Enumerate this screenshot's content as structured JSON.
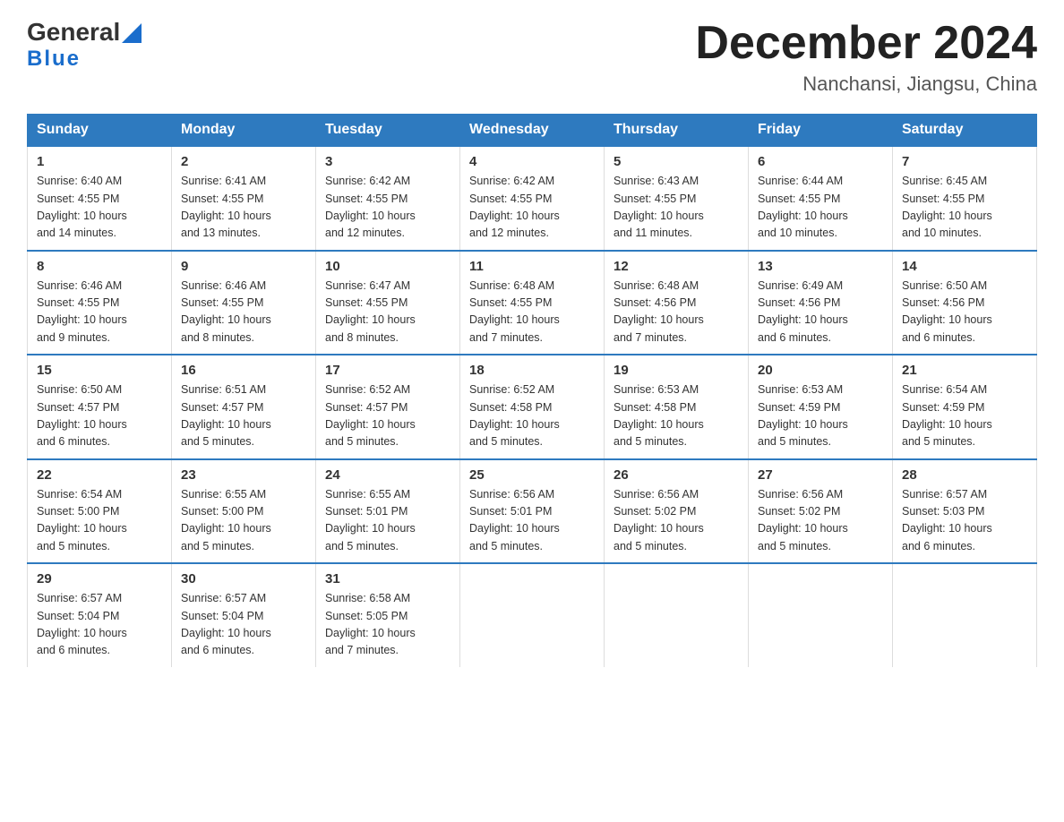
{
  "logo": {
    "text_general": "General",
    "text_blue": "Blue",
    "arrow_color": "#1a6dcc"
  },
  "title": "December 2024",
  "subtitle": "Nanchansi, Jiangsu, China",
  "days_of_week": [
    "Sunday",
    "Monday",
    "Tuesday",
    "Wednesday",
    "Thursday",
    "Friday",
    "Saturday"
  ],
  "weeks": [
    [
      {
        "day": "1",
        "sunrise": "6:40 AM",
        "sunset": "4:55 PM",
        "daylight": "10 hours and 14 minutes."
      },
      {
        "day": "2",
        "sunrise": "6:41 AM",
        "sunset": "4:55 PM",
        "daylight": "10 hours and 13 minutes."
      },
      {
        "day": "3",
        "sunrise": "6:42 AM",
        "sunset": "4:55 PM",
        "daylight": "10 hours and 12 minutes."
      },
      {
        "day": "4",
        "sunrise": "6:42 AM",
        "sunset": "4:55 PM",
        "daylight": "10 hours and 12 minutes."
      },
      {
        "day": "5",
        "sunrise": "6:43 AM",
        "sunset": "4:55 PM",
        "daylight": "10 hours and 11 minutes."
      },
      {
        "day": "6",
        "sunrise": "6:44 AM",
        "sunset": "4:55 PM",
        "daylight": "10 hours and 10 minutes."
      },
      {
        "day": "7",
        "sunrise": "6:45 AM",
        "sunset": "4:55 PM",
        "daylight": "10 hours and 10 minutes."
      }
    ],
    [
      {
        "day": "8",
        "sunrise": "6:46 AM",
        "sunset": "4:55 PM",
        "daylight": "10 hours and 9 minutes."
      },
      {
        "day": "9",
        "sunrise": "6:46 AM",
        "sunset": "4:55 PM",
        "daylight": "10 hours and 8 minutes."
      },
      {
        "day": "10",
        "sunrise": "6:47 AM",
        "sunset": "4:55 PM",
        "daylight": "10 hours and 8 minutes."
      },
      {
        "day": "11",
        "sunrise": "6:48 AM",
        "sunset": "4:55 PM",
        "daylight": "10 hours and 7 minutes."
      },
      {
        "day": "12",
        "sunrise": "6:48 AM",
        "sunset": "4:56 PM",
        "daylight": "10 hours and 7 minutes."
      },
      {
        "day": "13",
        "sunrise": "6:49 AM",
        "sunset": "4:56 PM",
        "daylight": "10 hours and 6 minutes."
      },
      {
        "day": "14",
        "sunrise": "6:50 AM",
        "sunset": "4:56 PM",
        "daylight": "10 hours and 6 minutes."
      }
    ],
    [
      {
        "day": "15",
        "sunrise": "6:50 AM",
        "sunset": "4:57 PM",
        "daylight": "10 hours and 6 minutes."
      },
      {
        "day": "16",
        "sunrise": "6:51 AM",
        "sunset": "4:57 PM",
        "daylight": "10 hours and 5 minutes."
      },
      {
        "day": "17",
        "sunrise": "6:52 AM",
        "sunset": "4:57 PM",
        "daylight": "10 hours and 5 minutes."
      },
      {
        "day": "18",
        "sunrise": "6:52 AM",
        "sunset": "4:58 PM",
        "daylight": "10 hours and 5 minutes."
      },
      {
        "day": "19",
        "sunrise": "6:53 AM",
        "sunset": "4:58 PM",
        "daylight": "10 hours and 5 minutes."
      },
      {
        "day": "20",
        "sunrise": "6:53 AM",
        "sunset": "4:59 PM",
        "daylight": "10 hours and 5 minutes."
      },
      {
        "day": "21",
        "sunrise": "6:54 AM",
        "sunset": "4:59 PM",
        "daylight": "10 hours and 5 minutes."
      }
    ],
    [
      {
        "day": "22",
        "sunrise": "6:54 AM",
        "sunset": "5:00 PM",
        "daylight": "10 hours and 5 minutes."
      },
      {
        "day": "23",
        "sunrise": "6:55 AM",
        "sunset": "5:00 PM",
        "daylight": "10 hours and 5 minutes."
      },
      {
        "day": "24",
        "sunrise": "6:55 AM",
        "sunset": "5:01 PM",
        "daylight": "10 hours and 5 minutes."
      },
      {
        "day": "25",
        "sunrise": "6:56 AM",
        "sunset": "5:01 PM",
        "daylight": "10 hours and 5 minutes."
      },
      {
        "day": "26",
        "sunrise": "6:56 AM",
        "sunset": "5:02 PM",
        "daylight": "10 hours and 5 minutes."
      },
      {
        "day": "27",
        "sunrise": "6:56 AM",
        "sunset": "5:02 PM",
        "daylight": "10 hours and 5 minutes."
      },
      {
        "day": "28",
        "sunrise": "6:57 AM",
        "sunset": "5:03 PM",
        "daylight": "10 hours and 6 minutes."
      }
    ],
    [
      {
        "day": "29",
        "sunrise": "6:57 AM",
        "sunset": "5:04 PM",
        "daylight": "10 hours and 6 minutes."
      },
      {
        "day": "30",
        "sunrise": "6:57 AM",
        "sunset": "5:04 PM",
        "daylight": "10 hours and 6 minutes."
      },
      {
        "day": "31",
        "sunrise": "6:58 AM",
        "sunset": "5:05 PM",
        "daylight": "10 hours and 7 minutes."
      },
      null,
      null,
      null,
      null
    ]
  ],
  "labels": {
    "sunrise": "Sunrise:",
    "sunset": "Sunset:",
    "daylight": "Daylight:"
  }
}
